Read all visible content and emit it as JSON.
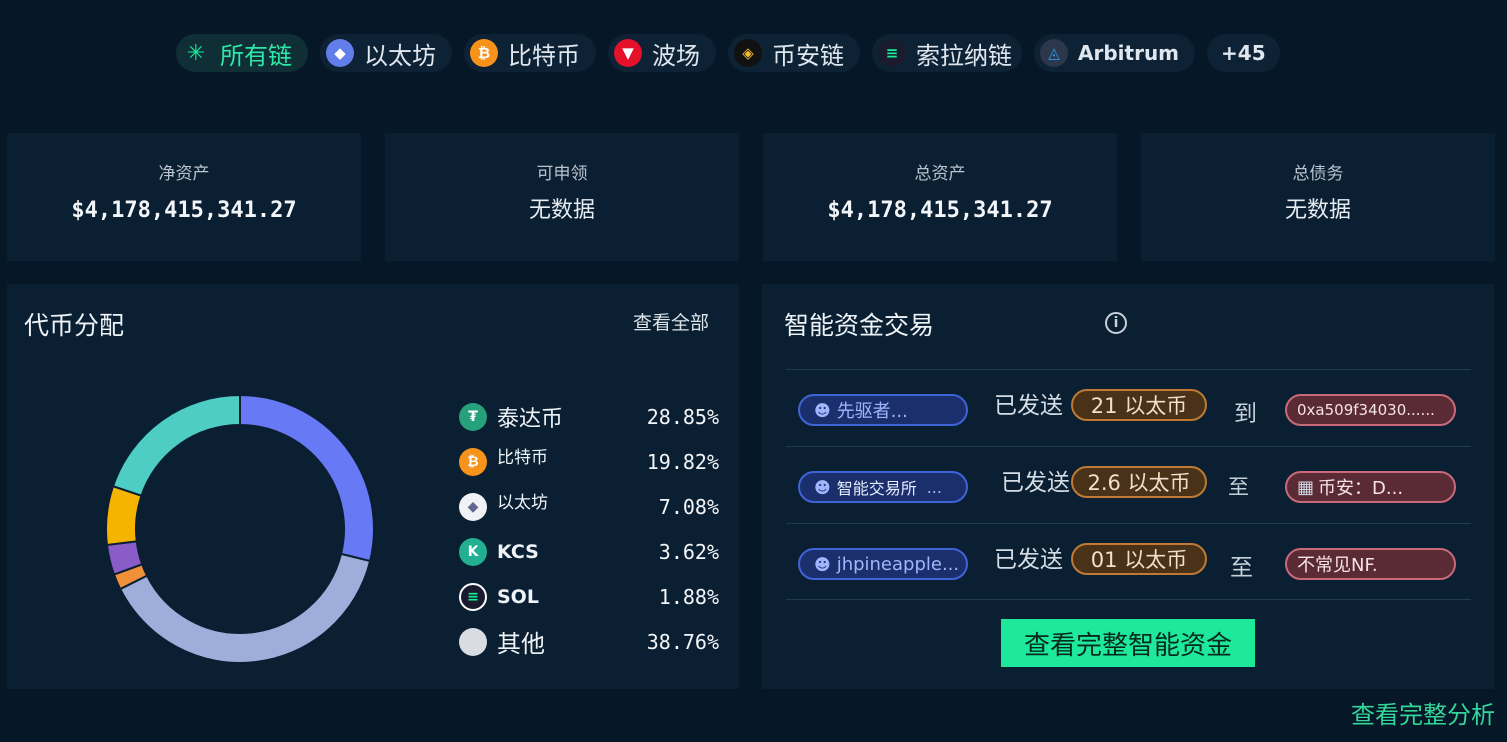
{
  "chains": [
    {
      "label": "所有链",
      "icon": "all-chains-icon",
      "color": "#1ee89a",
      "active": true
    },
    {
      "label": "以太坊",
      "icon": "ethereum-icon",
      "color": "#627eea"
    },
    {
      "label": "比特币",
      "icon": "bitcoin-icon",
      "color": "#f7931a"
    },
    {
      "label": "波场",
      "icon": "tron-icon",
      "color": "#e5112a"
    },
    {
      "label": "币安链",
      "icon": "bnb-icon",
      "color": "#f3ba2f"
    },
    {
      "label": "索拉纳链",
      "icon": "solana-icon",
      "color": "#9945ff"
    },
    {
      "label": "Arbitrum",
      "icon": "arbitrum-icon",
      "color": "#28a0f0"
    },
    {
      "label": "+45"
    }
  ],
  "stats": {
    "net_assets": {
      "label": "净资产",
      "value": "$4,178,415,341.27"
    },
    "claimable": {
      "label": "可申领",
      "value": "无数据"
    },
    "total_assets": {
      "label": "总资产",
      "value": "$4,178,415,341.27"
    },
    "total_debt": {
      "label": "总债务",
      "value": "无数据"
    }
  },
  "token_allocation": {
    "title": "代币分配",
    "view_all": "查看全部",
    "items": [
      {
        "name": "泰达币",
        "pct": "28.85%",
        "icon": "tether-icon",
        "color": "#26a17b"
      },
      {
        "name": "比特币",
        "pct": "19.82%",
        "icon": "bitcoin-icon",
        "color": "#f7931a"
      },
      {
        "name": "以太坊",
        "pct": "7.08%",
        "icon": "ethereum-icon",
        "color": "#8a92b2"
      },
      {
        "name": "KCS",
        "pct": "3.62%",
        "icon": "kucoin-icon",
        "color": "#23af91"
      },
      {
        "name": "SOL",
        "pct": "1.88%",
        "icon": "solana-icon",
        "color": "#1b1b2f"
      },
      {
        "name": "其他",
        "pct": "38.76%",
        "icon": "other-icon",
        "color": "#d9dde2"
      }
    ]
  },
  "chart_data": {
    "type": "pie",
    "categories": [
      "泰达币",
      "比特币",
      "以太坊",
      "KCS",
      "SOL",
      "其他"
    ],
    "values": [
      28.85,
      19.82,
      7.08,
      3.62,
      1.88,
      38.76
    ],
    "colors": [
      "#6779f5",
      "#4ecdc4",
      "#f4b400",
      "#8a5cc7",
      "#f0913a",
      "#9eaedb"
    ],
    "ring_order": [
      0,
      5,
      4,
      3,
      2,
      1
    ],
    "donut": true
  },
  "smart_money": {
    "title": "智能资金交易",
    "sent_label": "已发送",
    "rows": [
      {
        "from": "先驱者...",
        "amount": "21 以太币",
        "connector": "到",
        "to": "0xa509f34030......"
      },
      {
        "from": "智能交易所",
        "from_extra": "...",
        "amount": "2.6 以太币",
        "connector": "至",
        "to": "币安：D..."
      },
      {
        "from": "jhpineapple...",
        "amount": "01 以太币",
        "connector": "至",
        "to": "不常见NF."
      }
    ],
    "cta": "查看完整智能资金"
  },
  "footer": {
    "full_analysis": "查看完整分析"
  }
}
